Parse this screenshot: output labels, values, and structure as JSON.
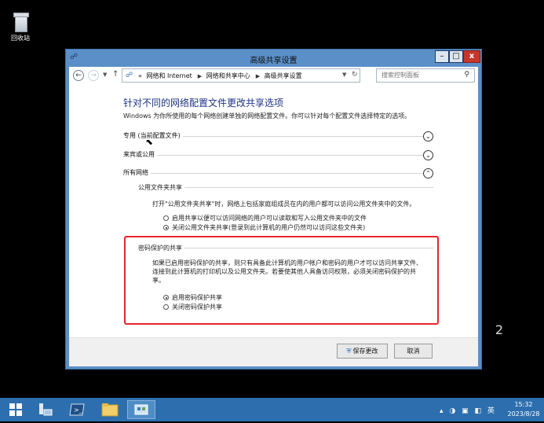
{
  "desktop": {
    "recycle_bin_label": "回收站",
    "edition_text": "2"
  },
  "window": {
    "title": "高级共享设置",
    "caption_buttons": {
      "minimize": "–",
      "maximize": "□",
      "close": "x"
    },
    "nav": {
      "back": "←",
      "forward": "→",
      "up": "↑",
      "breadcrumb_prefix": "«",
      "breadcrumbs": [
        "网络和 Internet",
        "网络和共享中心",
        "高级共享设置"
      ],
      "search_placeholder": "搜索控制面板"
    },
    "heading": "针对不同的网络配置文件更改共享选项",
    "description": "Windows 为你所使用的每个网络创建单独的网络配置文件。你可以针对每个配置文件选择特定的选项。",
    "sections": [
      {
        "label": "专用 (当前配置文件)",
        "state": "collapsed"
      },
      {
        "label": "来宾或公用",
        "state": "collapsed"
      },
      {
        "label": "所有网络",
        "state": "expanded"
      }
    ],
    "public_folder": {
      "label": "公用文件夹共享",
      "text": "打开\"公用文件夹共享\"时，网络上包括家庭组成员在内的用户都可以访问公用文件夹中的文件。",
      "options": [
        {
          "label": "启用共享以便可以访问网络的用户可以读取和写入公用文件夹中的文件",
          "selected": false
        },
        {
          "label": "关闭公用文件夹共享(登录到此计算机的用户仍然可以访问这些文件夹)",
          "selected": true
        }
      ]
    },
    "password_sharing": {
      "label": "密码保护的共享",
      "text_lines": [
        "如果已启用密码保护的共享，则只有具备此计算机的用户帐户和密码的用户才可以访问共享文件、",
        "连接到此计算机的打印机以及公用文件夹。若要使其他人具备访问权限，必须关闭密码保护的共",
        "享。"
      ],
      "options": [
        {
          "label": "启用密码保护共享",
          "selected": true
        },
        {
          "label": "关闭密码保护共享",
          "selected": false
        }
      ]
    },
    "footer": {
      "save_label": "保存更改",
      "cancel_label": "取消"
    }
  },
  "taskbar": {
    "time": "15:32",
    "date": "2023/8/28",
    "ime": "英"
  },
  "colors": {
    "window_frame": "#5b8fc7",
    "heading": "#1e3287",
    "highlight_box": "#e5252b",
    "taskbar": "#2d6fae"
  }
}
